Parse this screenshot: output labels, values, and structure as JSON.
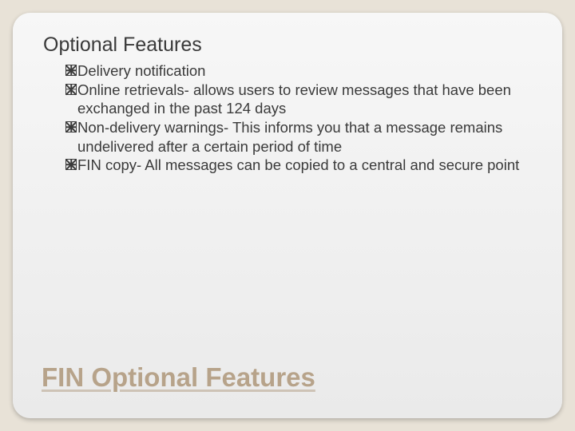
{
  "slide": {
    "heading": "Optional Features",
    "bullets": [
      "Delivery notification",
      "Online retrievals- allows users to review messages that have been exchanged in the past 124 days",
      "Non-delivery warnings- This informs you that a message remains undelivered after a certain period of time",
      "FIN copy- All messages can be copied to a central and secure point"
    ],
    "footer_title": "FIN Optional Features"
  }
}
